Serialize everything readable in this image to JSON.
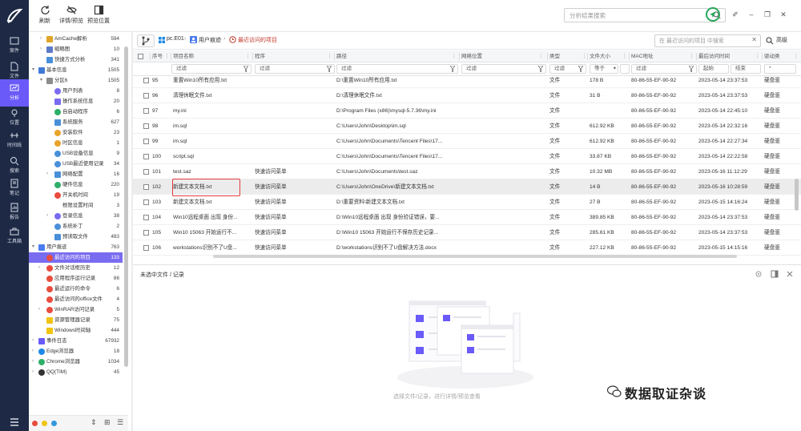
{
  "toolbar": {
    "refresh": "刷新",
    "details_preview": "详情/预览",
    "preview_position": "预览位置",
    "search_placeholder": "分析结果搜索"
  },
  "rail": {
    "items": [
      "案件",
      "文件",
      "分析",
      "位置",
      "时间线",
      "搜索",
      "笔记",
      "报告",
      "工具箱"
    ],
    "active": "分析"
  },
  "tree": {
    "items": [
      {
        "label": "AmCache解析",
        "count": "594"
      },
      {
        "label": "缩略图",
        "count": "10"
      },
      {
        "label": "快捷方式分析",
        "count": "341"
      },
      {
        "label": "基本信息",
        "count": "1505"
      },
      {
        "label": "分区6",
        "count": "1505"
      },
      {
        "label": "用户列表",
        "count": "8"
      },
      {
        "label": "操作系统信息",
        "count": "20"
      },
      {
        "label": "自启动程序",
        "count": "6"
      },
      {
        "label": "系统服务",
        "count": "627"
      },
      {
        "label": "安装软件",
        "count": "23"
      },
      {
        "label": "时区信息",
        "count": "1"
      },
      {
        "label": "USB设备信息",
        "count": "9"
      },
      {
        "label": "USB最近使用记录",
        "count": "34"
      },
      {
        "label": "网络配置",
        "count": "16"
      },
      {
        "label": "硬件信息",
        "count": "220"
      },
      {
        "label": "开关机时间",
        "count": "19"
      },
      {
        "label": "根限设置时间",
        "count": "3"
      },
      {
        "label": "登录信息",
        "count": "38"
      },
      {
        "label": "系统补丁",
        "count": "2"
      },
      {
        "label": "预读取文件",
        "count": "483"
      },
      {
        "label": "用户痕迹",
        "count": "763"
      },
      {
        "label": "最近访问的项目",
        "count": "133"
      },
      {
        "label": "文件对话框历史",
        "count": "12"
      },
      {
        "label": "应用程序运行记录",
        "count": "86"
      },
      {
        "label": "最近运行的命令",
        "count": "6"
      },
      {
        "label": "最近访问的office文件",
        "count": "4"
      },
      {
        "label": "WinRAR访问记录",
        "count": "5"
      },
      {
        "label": "资源管理器记录",
        "count": "75"
      },
      {
        "label": "Windows时间轴",
        "count": "444"
      },
      {
        "label": "事件日志",
        "count": "67932"
      },
      {
        "label": "Edge浏览器",
        "count": "18"
      },
      {
        "label": "Chrome浏览器",
        "count": "1034"
      },
      {
        "label": "QQ(TIM)",
        "count": "45"
      }
    ]
  },
  "breadcrumb": {
    "root": "pc.E01",
    "level1": "用户痕迹",
    "current": "最近访问的项目"
  },
  "filter_search": {
    "placeholder": "在 最近访问的项目 中搜索",
    "advanced": "高级"
  },
  "columns": [
    "序号",
    "项目名称",
    "程序",
    "路径",
    "网络位置",
    "类型",
    "文件大小",
    "MAC地址",
    "最后访问时间",
    "驱动类"
  ],
  "filters": {
    "text": "过滤",
    "size_op": "等于",
    "start": "起始",
    "end": "结束",
    "star": "*"
  },
  "rows": [
    {
      "no": "95",
      "name": "重置Win10所有应用.txt",
      "prog": "",
      "path": "D:\\重置Win10所有应用.txt",
      "type": "文件",
      "size": "178 B",
      "mac": "80-86-55-EF-90-92",
      "time": "2023-05-14 23:37:53",
      "drv": "硬盘驱"
    },
    {
      "no": "96",
      "name": "清理休眠文件.txt",
      "prog": "",
      "path": "D:\\清理休眠文件.txt",
      "type": "文件",
      "size": "31 B",
      "mac": "80-86-55-EF-90-92",
      "time": "2023-05-14 23:37:53",
      "drv": "硬盘驱"
    },
    {
      "no": "97",
      "name": "my.ini",
      "prog": "",
      "path": "D:\\Program Files (x86)\\mysql-5.7.36\\my.ini",
      "type": "文件",
      "size": "",
      "mac": "80-86-55-EF-90-92",
      "time": "2023-05-14 22:45:10",
      "drv": "硬盘驱"
    },
    {
      "no": "98",
      "name": "im.sql",
      "prog": "",
      "path": "C:\\Users\\John\\Desktop\\im.sql",
      "type": "文件",
      "size": "612.92 KB",
      "mac": "80-86-55-EF-90-92",
      "time": "2023-05-14 22:32:16",
      "drv": "硬盘驱"
    },
    {
      "no": "99",
      "name": "im.sql",
      "prog": "",
      "path": "C:\\Users\\John\\Documents\\Tencent Files\\17...",
      "type": "文件",
      "size": "612.92 KB",
      "mac": "80-86-55-EF-90-92",
      "time": "2023-05-14 22:27:34",
      "drv": "硬盘驱"
    },
    {
      "no": "100",
      "name": "script.sql",
      "prog": "",
      "path": "C:\\Users\\John\\Documents\\Tencent Files\\17...",
      "type": "文件",
      "size": "33.87 KB",
      "mac": "80-86-55-EF-90-92",
      "time": "2023-05-14 22:22:58",
      "drv": "硬盘驱"
    },
    {
      "no": "101",
      "name": "test.saz",
      "prog": "快速访问菜单",
      "path": "C:\\Users\\John\\Documents\\test.saz",
      "type": "文件",
      "size": "10.32 MB",
      "mac": "80-86-55-EF-90-92",
      "time": "2023-05-16 11:12:29",
      "drv": "硬盘驱"
    },
    {
      "no": "102",
      "name": "新建文本文档.txt",
      "prog": "快速访问菜单",
      "path": "C:\\Users\\John\\OneDrive\\新建文本文档.txt",
      "type": "文件",
      "size": "14 B",
      "mac": "80-86-55-EF-90-92",
      "time": "2023-05-16 10:28:59",
      "drv": "硬盘驱"
    },
    {
      "no": "103",
      "name": "新建文本文档.txt",
      "prog": "快速访问菜单",
      "path": "D:\\重要资料\\新建文本文档.txt",
      "type": "文件",
      "size": "27 B",
      "mac": "80-86-55-EF-90-92",
      "time": "2023-05-15 14:16:24",
      "drv": "硬盘驱"
    },
    {
      "no": "104",
      "name": "Win10远程桌面 出现 身份...",
      "prog": "快速访问菜单",
      "path": "D:\\Win10远程桌面 出现 身份验证错误，要...",
      "type": "文件",
      "size": "389.85 KB",
      "mac": "80-86-55-EF-90-92",
      "time": "2023-05-14 23:37:53",
      "drv": "硬盘驱"
    },
    {
      "no": "105",
      "name": "Win10 15063 开始运行不...",
      "prog": "快速访问菜单",
      "path": "D:\\Win10 15063 开始运行不保存历史记录...",
      "type": "文件",
      "size": "285.61 KB",
      "mac": "80-86-55-EF-90-92",
      "time": "2023-05-14 23:37:53",
      "drv": "硬盘驱"
    },
    {
      "no": "106",
      "name": "workstations识别不了U盘...",
      "prog": "快速访问菜单",
      "path": "D:\\workstations识别不了U盘解决方法.docx",
      "type": "文件",
      "size": "227.12 KB",
      "mac": "80-86-55-EF-90-92",
      "time": "2023-05-15 14:15:16",
      "drv": "硬盘驱"
    }
  ],
  "detail": {
    "title": "未选中文件 / 记录",
    "empty_text": "选择文件/记录，进行详情/预览查看"
  },
  "watermark": "数据取证杂谈",
  "colors": {
    "rail_bg": "#1e2a45",
    "accent": "#6a5af9",
    "highlight_border": "#e23a3a"
  }
}
